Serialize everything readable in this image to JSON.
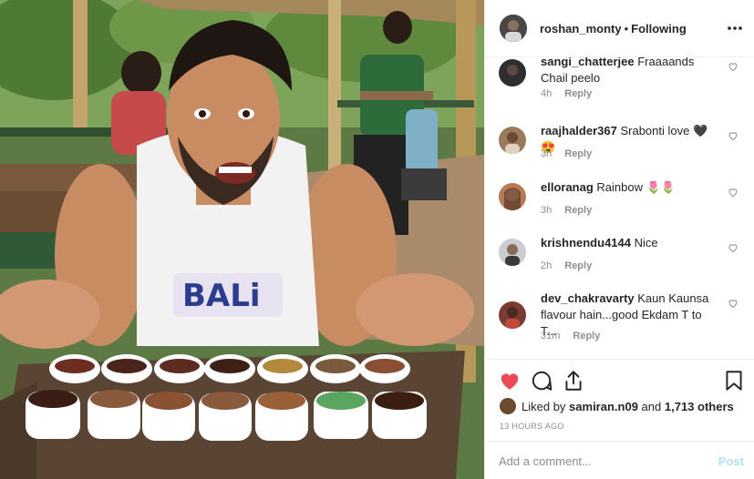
{
  "post": {
    "photo_alt": "",
    "shirt_text": "BALi"
  },
  "header": {
    "username": "roshan_monty",
    "separator": "•",
    "follow_status": "Following",
    "more_icon": "more-horizontal-icon"
  },
  "comments": [
    {
      "username": "sangi_chatterjee",
      "text": "Fraaaands Chail peelo",
      "time": "4h",
      "reply": "Reply",
      "avatar_color": "#2e2e2e"
    },
    {
      "username": "raajhalder367",
      "text": "Srabonti love 🖤😍",
      "time": "3h",
      "reply": "Reply",
      "avatar_color": "#9a7a5c"
    },
    {
      "username": "elloranag",
      "text": "Rainbow 🌷🌷",
      "time": "3h",
      "reply": "Reply",
      "avatar_color": "#b87b58"
    },
    {
      "username": "krishnendu4144",
      "text": "Nice",
      "time": "2h",
      "reply": "Reply",
      "avatar_color": "#c9ccd1"
    },
    {
      "username": "dev_chakravarty",
      "text": "Kaun Kaunsa flavour hain...good Ekdam T to T...",
      "time": "31m",
      "reply": "Reply",
      "avatar_color": "#7a3b33"
    }
  ],
  "actions": {
    "like_icon": "heart-filled-icon",
    "comment_icon": "comment-icon",
    "share_icon": "share-icon",
    "save_icon": "bookmark-icon",
    "liked_prefix": "Liked by",
    "liked_user": "samiran.n09",
    "liked_and": "and",
    "liked_count": "1,713 others",
    "date": "13 HOURS AGO"
  },
  "add_comment": {
    "placeholder": "Add a comment...",
    "post_label": "Post"
  },
  "colors": {
    "like_red": "#ed4956",
    "post_disabled": "#b2dffc",
    "meta_gray": "#8e8e8e",
    "divider": "#efefef"
  }
}
